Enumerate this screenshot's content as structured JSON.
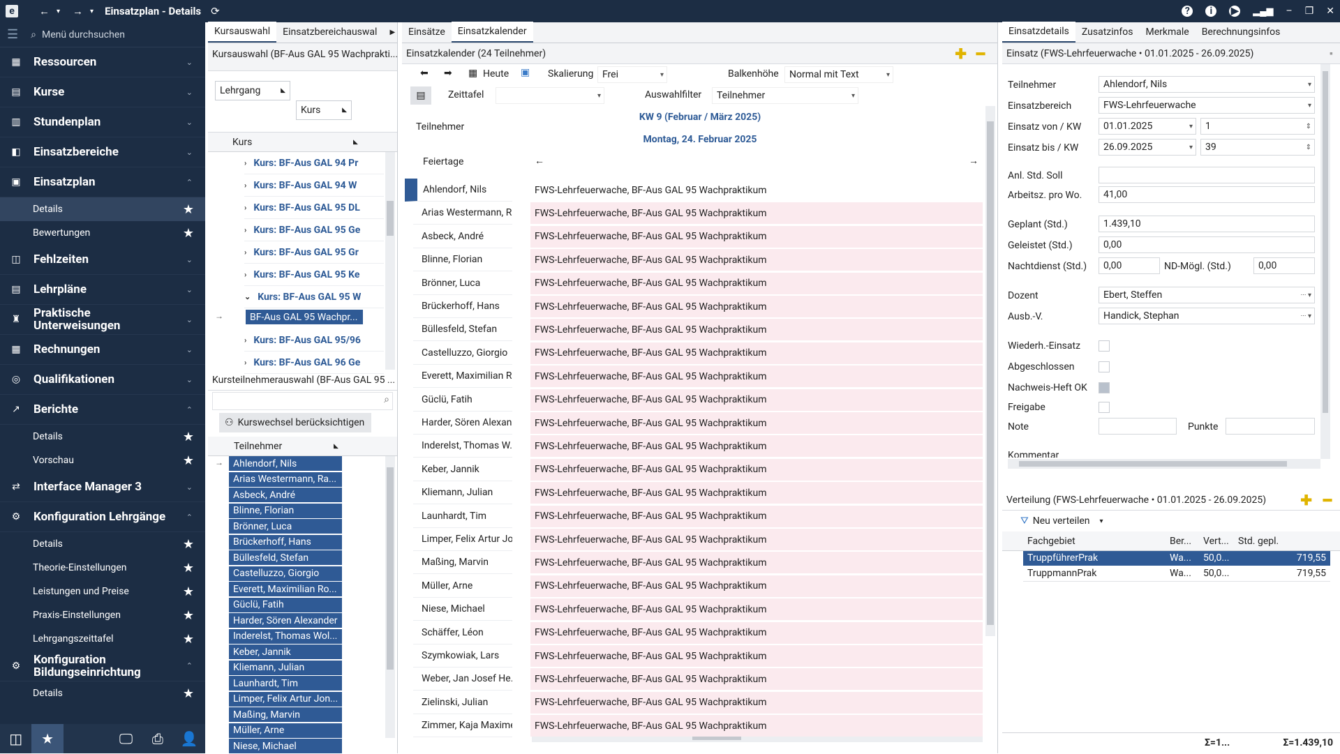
{
  "window": {
    "title": "Einsatzplan - Details"
  },
  "sidebar": {
    "search_placeholder": "Menü durchsuchen",
    "items": [
      {
        "label": "Ressourcen"
      },
      {
        "label": "Kurse"
      },
      {
        "label": "Stundenplan"
      },
      {
        "label": "Einsatzbereiche"
      },
      {
        "label": "Einsatzplan"
      }
    ],
    "einsatzplan_subs": [
      "Details",
      "Bewertungen"
    ],
    "items2": [
      "Fehlzeiten",
      "Lehrpläne",
      "Praktische Unterweisungen",
      "Rechnungen",
      "Qualifikationen",
      "Berichte"
    ],
    "berichte_subs": [
      "Details",
      "Vorschau"
    ],
    "items3": [
      "Interface Manager 3",
      "Konfiguration Lehrgänge"
    ],
    "konfig_subs": [
      "Details",
      "Theorie-Einstellungen",
      "Leistungen und Preise",
      "Praxis-Einstellungen",
      "Lehrgangszeittafel"
    ],
    "items4": [
      "Konfiguration Bildungseinrichtung"
    ],
    "bildung_subs": [
      "Details"
    ]
  },
  "left_panel": {
    "tabs": [
      "Kursauswahl",
      "Einsatzbereichauswal"
    ],
    "header": "Kursauswahl (BF-Aus GAL 95 Wachprakti...",
    "group1": "Lehrgang",
    "group2": "Kurs",
    "col": "Kurs",
    "courses": [
      "Kurs: BF-Aus GAL 94 Pr",
      "Kurs: BF-Aus GAL 94 W",
      "Kurs: BF-Aus GAL 95 DL",
      "Kurs: BF-Aus GAL 95 Ge",
      "Kurs: BF-Aus GAL 95 Gr",
      "Kurs: BF-Aus GAL 95 Ke",
      "Kurs: BF-Aus GAL 95 W"
    ],
    "selected_course": "BF-Aus GAL 95 Wachpr...",
    "courses_after": [
      "Kurs: BF-Aus GAL 95/96",
      "Kurs: BF-Aus GAL 96 Ge"
    ],
    "participants_header": "Kursteilnehmerauswahl (BF-Aus GAL 95 ...",
    "kurswechsel": "Kurswechsel berücksichtigen",
    "col2": "Teilnehmer",
    "participants": [
      "Ahlendorf, Nils",
      "Arias Westermann, Ra...",
      "Asbeck, André",
      "Blinne, Florian",
      "Brönner, Luca",
      "Brückerhoff, Hans",
      "Büllesfeld, Stefan",
      "Castelluzzo, Giorgio",
      "Everett, Maximilian Ro...",
      "Güclü, Fatih",
      "Harder, Sören Alexander",
      "Inderelst, Thomas Wol...",
      "Keber, Jannik",
      "Kliemann, Julian",
      "Launhardt, Tim",
      "Limper, Felix Artur Jon...",
      "Maßing, Marvin",
      "Müller, Arne",
      "Niese, Michael"
    ]
  },
  "center": {
    "tabs": [
      "Einsätze",
      "Einsatzkalender"
    ],
    "header": "Einsatzkalender (24 Teilnehmer)",
    "heute": "Heute",
    "skalierung_label": "Skalierung",
    "skalierung_value": "Frei",
    "balken_label": "Balkenhöhe",
    "balken_value": "Normal mit Text",
    "zeittafel": "Zeittafel",
    "auswahlfilter_label": "Auswahlfilter",
    "auswahlfilter_value": "Teilnehmer",
    "col_teilnehmer": "Teilnehmer",
    "kw": "KW 9 (Februar / März 2025)",
    "day": "Montag, 24. Februar 2025",
    "feiertage": "Feiertage",
    "rows": [
      "Ahlendorf, Nils",
      "Arias Westermann, R...",
      "Asbeck, André",
      "Blinne, Florian",
      "Brönner, Luca",
      "Brückerhoff, Hans",
      "Büllesfeld, Stefan",
      "Castelluzzo, Giorgio",
      "Everett, Maximilian R...",
      "Güclü, Fatih",
      "Harder, Sören Alexan...",
      "Inderelst, Thomas W...",
      "Keber, Jannik",
      "Kliemann, Julian",
      "Launhardt, Tim",
      "Limper, Felix Artur Jo...",
      "Maßing, Marvin",
      "Müller, Arne",
      "Niese, Michael",
      "Schäffer, Léon",
      "Szymkowiak, Lars",
      "Weber, Jan Josef He...",
      "Zielinski, Julian",
      "Zimmer, Kaja Maxime"
    ],
    "event_text": "FWS-Lehrfeuerwache, BF-Aus GAL 95 Wachpraktikum"
  },
  "right": {
    "tabs": [
      "Einsatzdetails",
      "Zusatzinfos",
      "Merkmale",
      "Berechnungsinfos"
    ],
    "header": "Einsatz (FWS-Lehrfeuerwache • 01.01.2025 - 26.09.2025)",
    "fields": {
      "teilnehmer_label": "Teilnehmer",
      "teilnehmer": "Ahlendorf, Nils",
      "bereich_label": "Einsatzbereich",
      "bereich": "FWS-Lehrfeuerwache",
      "von_label": "Einsatz von / KW",
      "von": "01.01.2025",
      "von_kw": "1",
      "bis_label": "Einsatz bis / KW",
      "bis": "26.09.2025",
      "bis_kw": "39",
      "anl_label": "Anl. Std. Soll",
      "anl": "",
      "arbeitsz_label": "Arbeitsz. pro Wo.",
      "arbeitsz": "41,00",
      "geplant_label": "Geplant (Std.)",
      "geplant": "1.439,10",
      "geleistet_label": "Geleistet (Std.)",
      "geleistet": "0,00",
      "nacht_label": "Nachtdienst (Std.)",
      "nacht": "0,00",
      "nd_label": "ND-Mögl. (Std.)",
      "nd": "0,00",
      "dozent_label": "Dozent",
      "dozent": "Ebert, Steffen",
      "ausb_label": "Ausb.-V.",
      "ausb": "Handick, Stephan",
      "wiederh_label": "Wiederh.-Einsatz",
      "abgeschl_label": "Abgeschlossen",
      "nachweis_label": "Nachweis-Heft OK",
      "freigabe_label": "Freigabe",
      "note_label": "Note",
      "punkte_label": "Punkte",
      "kommentar_label": "Kommentar"
    },
    "verteilung_header": "Verteilung (FWS-Lehrfeuerwache • 01.01.2025 - 26.09.2025)",
    "neu_verteilen": "Neu verteilen",
    "cols": [
      "Fachgebiet",
      "Ber...",
      "Vert...",
      "Std. gepl."
    ],
    "rows": [
      {
        "fach": "TruppführerPrak",
        "ber": "Wa...",
        "vert": "50,0...",
        "std": "719,55"
      },
      {
        "fach": "TruppmannPrak",
        "ber": "Wa...",
        "vert": "50,0...",
        "std": "719,55"
      }
    ],
    "sum1": "Σ=1...",
    "sum2": "Σ=1.439,10"
  }
}
